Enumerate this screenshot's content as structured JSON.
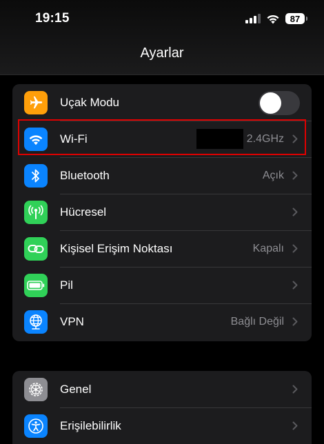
{
  "status_bar": {
    "time": "19:15",
    "battery": "87"
  },
  "header": {
    "title": "Ayarlar"
  },
  "group1": [
    {
      "label": "Uçak Modu",
      "icon": "airplane-icon",
      "icon_bg": "#ff9f0a",
      "toggle": "off"
    },
    {
      "label": "Wi-Fi",
      "value": "2.4GHz",
      "icon": "wifi-icon",
      "icon_bg": "#0a84ff"
    },
    {
      "label": "Bluetooth",
      "value": "Açık",
      "icon": "bluetooth-icon",
      "icon_bg": "#0a84ff"
    },
    {
      "label": "Hücresel",
      "value": "",
      "icon": "antenna-icon",
      "icon_bg": "#30d158"
    },
    {
      "label": "Kişisel Erişim Noktası",
      "value": "Kapalı",
      "icon": "link-icon",
      "icon_bg": "#30d158"
    },
    {
      "label": "Pil",
      "value": "",
      "icon": "battery-icon",
      "icon_bg": "#30d158"
    },
    {
      "label": "VPN",
      "value": "Bağlı Değil",
      "icon": "globe-icon",
      "icon_bg": "#0a84ff"
    }
  ],
  "group2": [
    {
      "label": "Genel",
      "icon": "gear-icon",
      "icon_bg": "#8e8e93"
    },
    {
      "label": "Erişilebilirlik",
      "icon": "accessibility-icon",
      "icon_bg": "#0a84ff"
    }
  ],
  "colors": {
    "highlight": "#e00000",
    "background": "#000000",
    "group_background": "#1c1c1e"
  }
}
